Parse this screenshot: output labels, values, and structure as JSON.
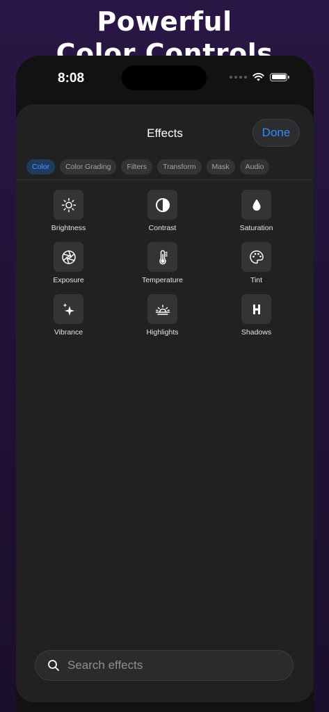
{
  "promo": {
    "line1": "Powerful",
    "line2": "Color Controls"
  },
  "status_bar": {
    "time": "8:08",
    "icons": [
      "signal-dots-icon",
      "wifi-icon",
      "battery-icon"
    ]
  },
  "sheet": {
    "title": "Effects",
    "done_label": "Done"
  },
  "tabs": [
    {
      "label": "Color",
      "active": true
    },
    {
      "label": "Color Grading",
      "active": false
    },
    {
      "label": "Filters",
      "active": false
    },
    {
      "label": "Transform",
      "active": false
    },
    {
      "label": "Mask",
      "active": false
    },
    {
      "label": "Audio",
      "active": false
    }
  ],
  "effects": [
    {
      "label": "Brightness",
      "icon": "sun-icon"
    },
    {
      "label": "Contrast",
      "icon": "half-circle-icon"
    },
    {
      "label": "Saturation",
      "icon": "drop-icon"
    },
    {
      "label": "Exposure",
      "icon": "aperture-icon"
    },
    {
      "label": "Temperature",
      "icon": "thermometer-icon"
    },
    {
      "label": "Tint",
      "icon": "palette-icon"
    },
    {
      "label": "Vibrance",
      "icon": "sparkles-icon"
    },
    {
      "label": "Highlights",
      "icon": "sunrise-icon"
    },
    {
      "label": "Shadows",
      "icon": "shadow-h-icon"
    }
  ],
  "search": {
    "placeholder": "Search effects",
    "value": ""
  },
  "colors": {
    "accent": "#2f8cf7",
    "sheet_background": "#212122",
    "tile_background": "#343436",
    "active_tab_background": "#1f3a5e"
  }
}
